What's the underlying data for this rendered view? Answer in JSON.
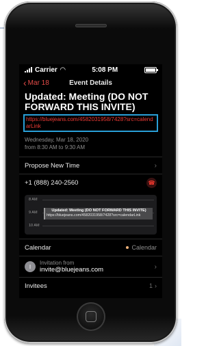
{
  "status_bar": {
    "carrier": "Carrier",
    "time": "5:08 PM"
  },
  "nav": {
    "back_label": "Mar 18",
    "title": "Event Details"
  },
  "event": {
    "title": "Updated: Meeting  (DO NOT FORWARD THIS INVITE)",
    "link": "https://bluejeans.com/4582031958/7428?src=calendarLink",
    "date_line": "Wednesday, Mar 18, 2020",
    "time_line": "from 8:30 AM to 9:30 AM"
  },
  "actions": {
    "propose_label": "Propose New Time",
    "phone_number": "+1 (888) 240-2560"
  },
  "calendar_preview": {
    "hours": [
      "8 AM",
      "9 AM",
      "10 AM"
    ],
    "event_title": "Updated: Meeting  (DO NOT FORWARD THIS INVITE)",
    "event_link": "https://bluejeans.com/4582031958/7428?src=calendarLink"
  },
  "calendar_row": {
    "label": "Calendar",
    "value": "Calendar",
    "dot_color": "#f0b27a"
  },
  "invitation": {
    "avatar_initial": "I",
    "label": "Invitation from",
    "email": "invite@bluejeans.com"
  },
  "invitees": {
    "label": "Invitees",
    "count": "1"
  },
  "colors": {
    "accent_red": "#e34b47",
    "highlight_box": "#2aa0d8"
  }
}
